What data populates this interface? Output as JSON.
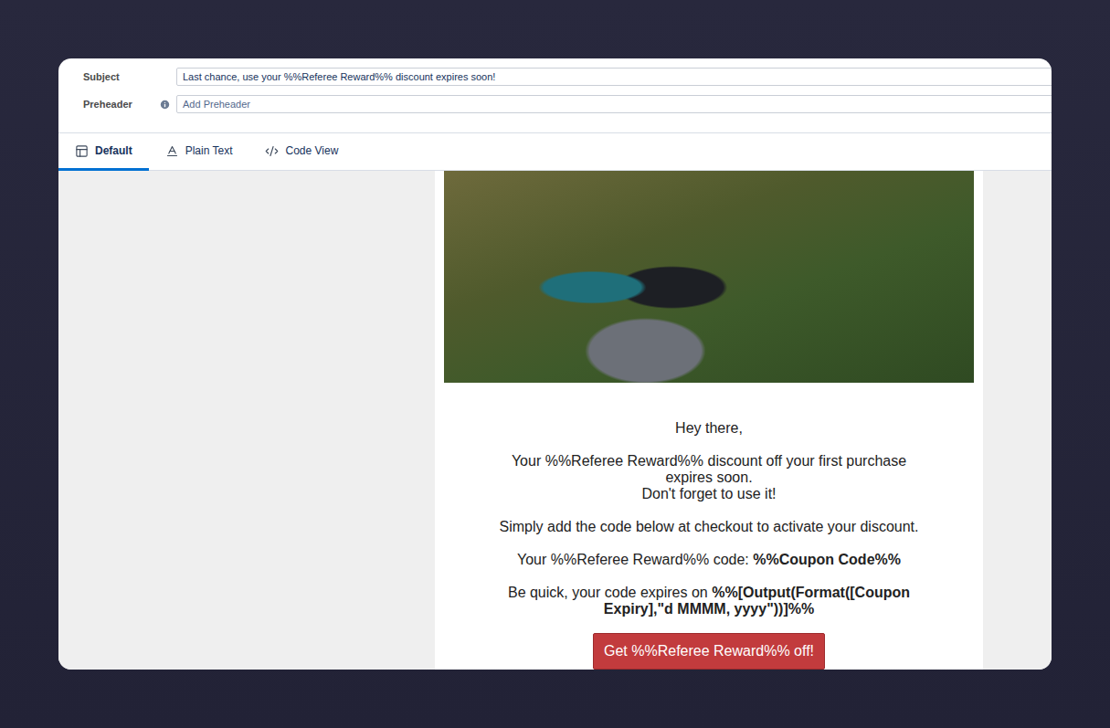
{
  "header": {
    "subject": {
      "label": "Subject",
      "value": "Last chance, use your %%Referee Reward%% discount expires soon!"
    },
    "preheader": {
      "label": "Preheader",
      "placeholder": "Add Preheader"
    }
  },
  "tabs": [
    {
      "label": "Default",
      "selected": true,
      "kind": "layout"
    },
    {
      "label": "Plain Text",
      "selected": false,
      "kind": "text"
    },
    {
      "label": "Code View",
      "selected": false,
      "kind": "code"
    }
  ],
  "email": {
    "greeting": "Hey there,",
    "intro": [
      "Your %%Referee Reward%% discount off your first purchase expires soon.",
      "Don't forget to use it!"
    ],
    "instruction": "Simply add the code below at checkout to activate your discount.",
    "code_line": {
      "label": "Your %%Referee Reward%% code: ",
      "code": "%%Coupon Code%%"
    },
    "expiry_line": {
      "label": "Be quick, your code expires on ",
      "value": "%%[Output(Format([Coupon Expiry],\"d MMMM, yyyy\"))]%%"
    },
    "button": "Get %%Referee Reward%% off!"
  }
}
